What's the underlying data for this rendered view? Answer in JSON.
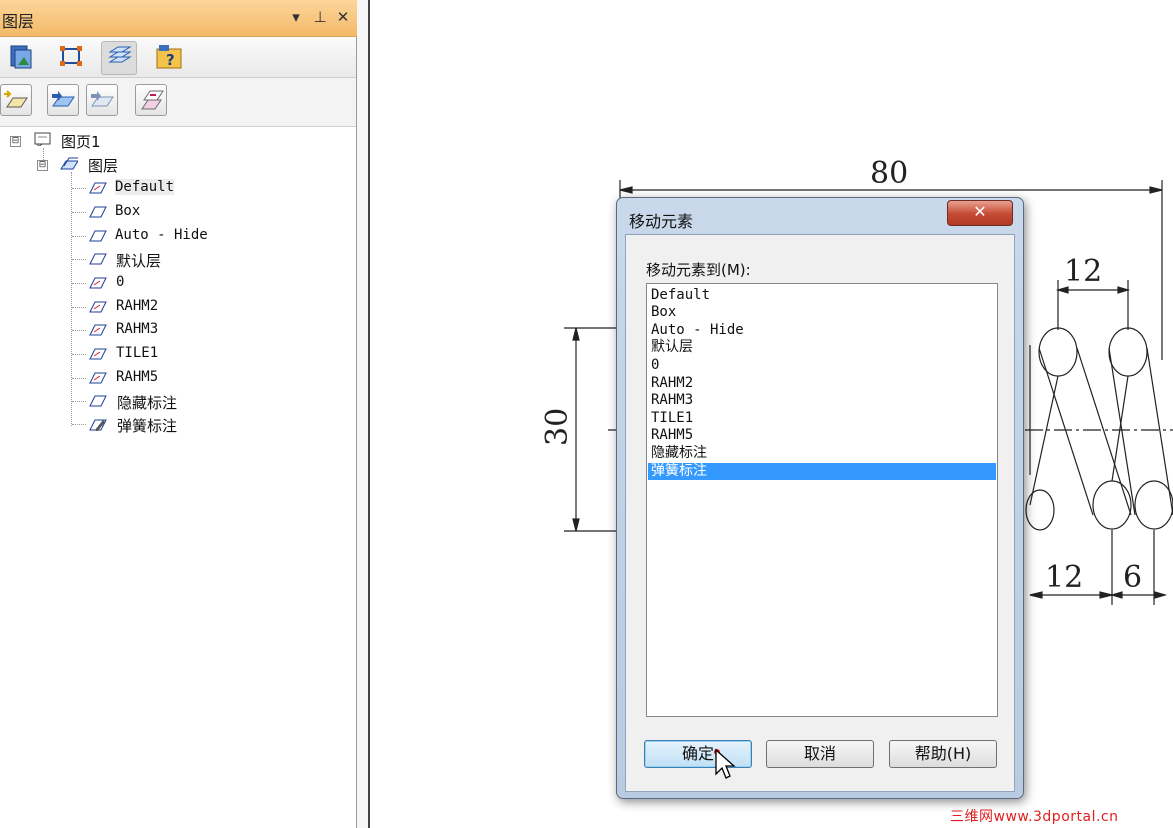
{
  "panel": {
    "title": "图层",
    "controls": {
      "dropdown_glyph": "▾",
      "pin_glyph": "⊥",
      "close_glyph": "✕"
    },
    "tabs": [
      {
        "icon": "sheet-properties-icon"
      },
      {
        "icon": "select-group-icon"
      },
      {
        "icon": "layers-icon",
        "active": true
      },
      {
        "icon": "help-panel-icon"
      }
    ],
    "toolbar": [
      {
        "icon": "new-layer-icon"
      },
      {
        "icon": "activate-layer-icon"
      },
      {
        "icon": "hide-layer-icon"
      },
      {
        "icon": "move-elements-icon"
      }
    ],
    "tree": {
      "root": {
        "label": "图页1",
        "expander": "⊟"
      },
      "group": {
        "label": "图层",
        "expander": "⊟"
      },
      "layers": [
        "Default",
        "Box",
        "Auto - Hide",
        "默认层",
        "0",
        "RAHM2",
        "RAHM3",
        "TILE1",
        "RAHM5",
        "隐藏标注",
        "弹簧标注"
      ],
      "active_layer": "弹簧标注"
    }
  },
  "drawing": {
    "dimensions": {
      "overall_width": "80",
      "height": "30",
      "pitch_top": "12",
      "pitch_bottom": "12",
      "wire": "6"
    }
  },
  "dialog": {
    "title": "移动元素",
    "close_glyph": "✕",
    "list_label": "移动元素到(M):",
    "items": [
      "Default",
      "Box",
      "Auto - Hide",
      "默认层",
      "0",
      "RAHM2",
      "RAHM3",
      "TILE1",
      "RAHM5",
      "隐藏标注",
      "弹簧标注"
    ],
    "selected": "弹簧标注",
    "buttons": {
      "ok": "确定",
      "cancel": "取消",
      "help": "帮助(H)"
    }
  },
  "watermark": "三维网www.3dportal.cn",
  "colors": {
    "panel_title": "#f4b96a",
    "selection": "#3399ff",
    "close_button": "#c44a33",
    "watermark": "#e02020"
  }
}
